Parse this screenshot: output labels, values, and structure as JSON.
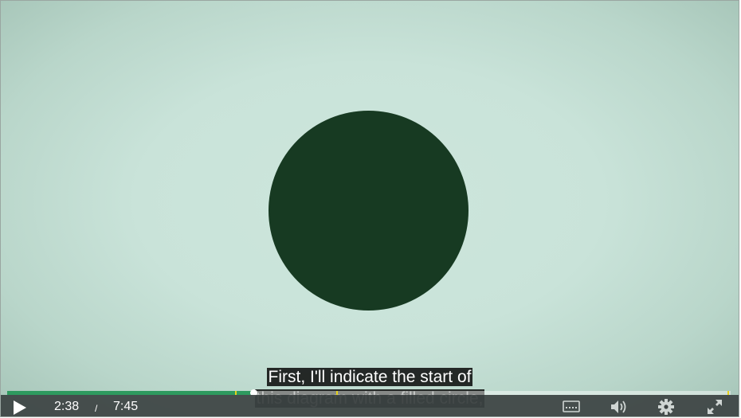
{
  "captions": {
    "line1": "First, I'll indicate the start of",
    "line2": "this diagram with a filled circle,"
  },
  "player": {
    "current_time": "2:38",
    "time_separator": "/",
    "total_time": "7:45",
    "progress_fraction": 0.34,
    "chapter_marks": [
      0.3145,
      0.4545,
      0.996
    ],
    "colors": {
      "progress": "#2e9a5f",
      "chapter_mark": "#e6d21c",
      "circle": "#173a22"
    }
  },
  "icons": {
    "play": "play-icon",
    "captions": "captions-icon",
    "volume": "volume-icon",
    "settings": "gear-icon",
    "fullscreen": "fullscreen-icon"
  }
}
